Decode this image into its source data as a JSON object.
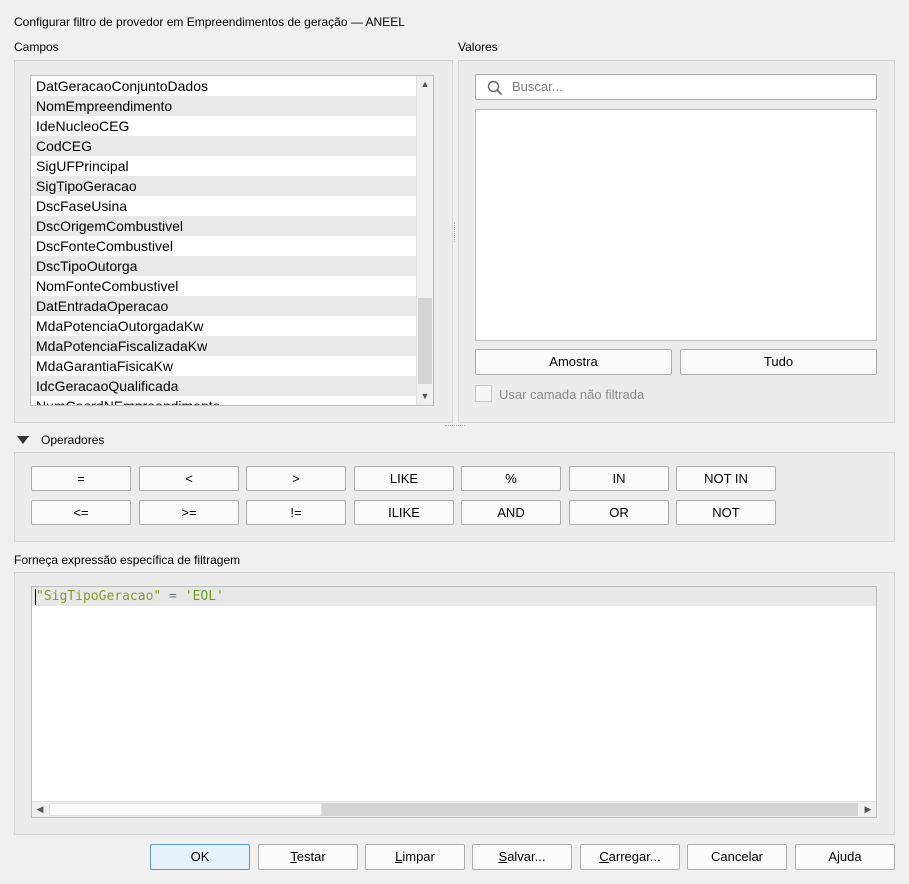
{
  "window": {
    "title": "Configurar filtro de provedor em Empreendimentos de geração — ANEEL"
  },
  "fields": {
    "label": "Campos",
    "items": [
      "DatGeracaoConjuntoDados",
      "NomEmpreendimento",
      "IdeNucleoCEG",
      "CodCEG",
      "SigUFPrincipal",
      "SigTipoGeracao",
      "DscFaseUsina",
      "DscOrigemCombustivel",
      "DscFonteCombustivel",
      "DscTipoOutorga",
      "NomFonteCombustivel",
      "DatEntradaOperacao",
      "MdaPotenciaOutorgadaKw",
      "MdaPotenciaFiscalizadaKw",
      "MdaGarantiaFisicaKw",
      "IdcGeracaoQualificada",
      "NumCoordNEmpreendimento"
    ]
  },
  "values": {
    "label": "Valores",
    "search_placeholder": "Buscar...",
    "sample_button": "Amostra",
    "all_button": "Tudo",
    "unfiltered_checkbox_label": "Usar camada não filtrada"
  },
  "operators": {
    "label": "Operadores",
    "row1": [
      "=",
      "<",
      ">",
      "LIKE",
      "%",
      "IN",
      "NOT IN"
    ],
    "row2": [
      "<=",
      ">=",
      "!=",
      "ILIKE",
      "AND",
      "OR",
      "NOT"
    ]
  },
  "expression": {
    "label": "Forneça expressão específica de filtragem",
    "field": "\"SigTipoGeracao\"",
    "op": " = ",
    "value": "'EOL'"
  },
  "footer": {
    "ok": "OK",
    "test_u": "T",
    "test_rest": "estar",
    "clear_u": "L",
    "clear_rest": "impar",
    "save_u": "S",
    "save_rest": "alvar...",
    "load_u": "C",
    "load_rest": "arregar...",
    "cancel": "Cancelar",
    "help": "Ajuda"
  },
  "colors": {
    "expr_field": "#8a9a2a",
    "expr_value": "#6aa01e",
    "expr_op": "#708090"
  }
}
